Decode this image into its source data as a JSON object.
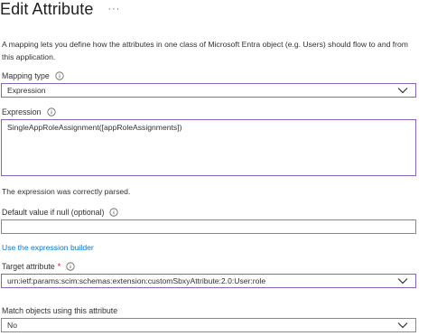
{
  "header": {
    "title": "Edit Attribute",
    "more_label": "···"
  },
  "description": "A mapping lets you define how the attributes in one class of Microsoft Entra object (e.g. Users) should flow to and from this application.",
  "mapping_type": {
    "label": "Mapping type",
    "value": "Expression"
  },
  "expression": {
    "label": "Expression",
    "value": "SingleAppRoleAssignment([appRoleAssignments])"
  },
  "status_text": "The expression was correctly parsed.",
  "default_value": {
    "label": "Default value if null (optional)",
    "value": ""
  },
  "expression_builder_link": "Use the expression builder",
  "target_attribute": {
    "label": "Target attribute",
    "required_mark": "*",
    "value": "urn:ietf:params:scim:schemas:extension:customSbxyAttribute:2.0:User:role"
  },
  "match_objects": {
    "label": "Match objects using this attribute",
    "value": "No"
  },
  "colors": {
    "accent_border": "#8764b8",
    "link": "#0078d4",
    "required": "#a4262c"
  }
}
